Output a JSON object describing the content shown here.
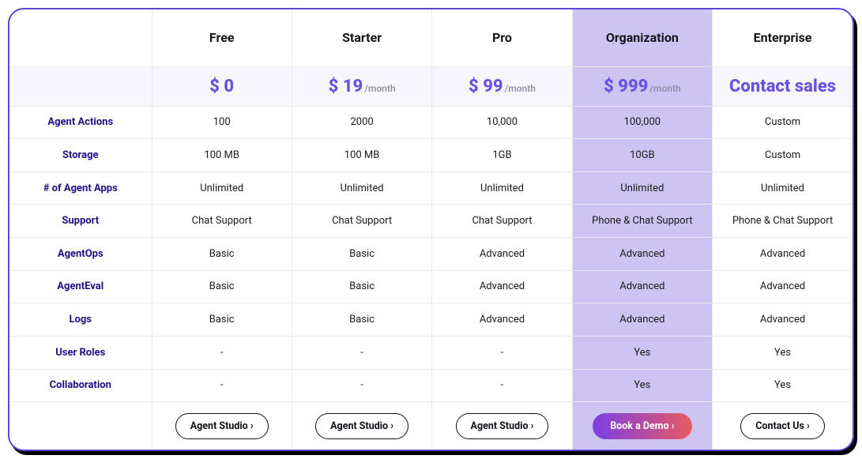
{
  "plans": {
    "free": {
      "name": "Free",
      "price": "$ 0",
      "per": "",
      "cta": "Agent Studio ›"
    },
    "starter": {
      "name": "Starter",
      "price": "$ 19",
      "per": "/month",
      "cta": "Agent Studio ›"
    },
    "pro": {
      "name": "Pro",
      "price": "$ 99",
      "per": "/month",
      "cta": "Agent Studio ›"
    },
    "org": {
      "name": "Organization",
      "price": "$ 999",
      "per": "/month",
      "cta": "Book a Demo ›"
    },
    "enterprise": {
      "name": "Enterprise",
      "price_text": "Contact sales",
      "cta": "Contact Us ›"
    }
  },
  "rows": {
    "actions": {
      "label": "Agent Actions",
      "free": "100",
      "starter": "2000",
      "pro": "10,000",
      "org": "100,000",
      "enterprise": "Custom"
    },
    "storage": {
      "label": "Storage",
      "free": "100 MB",
      "starter": "100 MB",
      "pro": "1GB",
      "org": "10GB",
      "enterprise": "Custom"
    },
    "apps": {
      "label": "# of Agent Apps",
      "free": "Unlimited",
      "starter": "Unlimited",
      "pro": "Unlimited",
      "org": "Unlimited",
      "enterprise": "Unlimited"
    },
    "support": {
      "label": "Support",
      "free": "Chat Support",
      "starter": "Chat Support",
      "pro": "Chat Support",
      "org": "Phone & Chat Support",
      "enterprise": "Phone & Chat Support"
    },
    "agentops": {
      "label": "AgentOps",
      "free": "Basic",
      "starter": "Basic",
      "pro": "Advanced",
      "org": "Advanced",
      "enterprise": "Advanced"
    },
    "agenteval": {
      "label": "AgentEval",
      "free": "Basic",
      "starter": "Basic",
      "pro": "Advanced",
      "org": "Advanced",
      "enterprise": "Advanced"
    },
    "logs": {
      "label": "Logs",
      "free": "Basic",
      "starter": "Basic",
      "pro": "Advanced",
      "org": "Advanced",
      "enterprise": "Advanced"
    },
    "roles": {
      "label": "User Roles",
      "free": "-",
      "starter": "-",
      "pro": "-",
      "org": "Yes",
      "enterprise": "Yes"
    },
    "collab": {
      "label": "Collaboration",
      "free": "-",
      "starter": "-",
      "pro": "-",
      "org": "Yes",
      "enterprise": "Yes"
    }
  }
}
